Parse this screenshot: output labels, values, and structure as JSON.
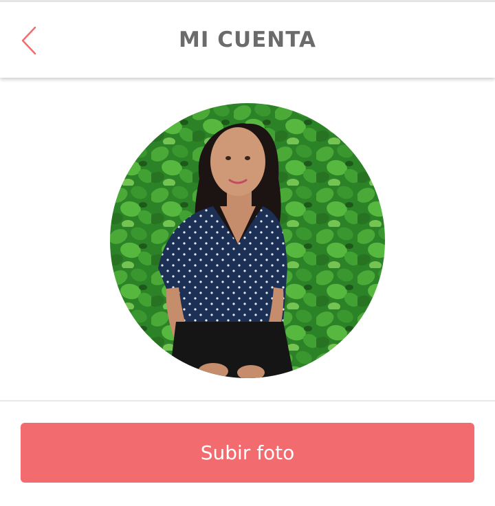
{
  "header": {
    "title": "MI CUENTA",
    "back_icon": "chevron-left-icon"
  },
  "profile": {
    "photo_description": "profile-photo"
  },
  "actions": {
    "upload_label": "Subir foto"
  },
  "colors": {
    "accent": "#f26b6f",
    "title_text": "#6b6b6b",
    "back_icon": "#f26b6f"
  }
}
